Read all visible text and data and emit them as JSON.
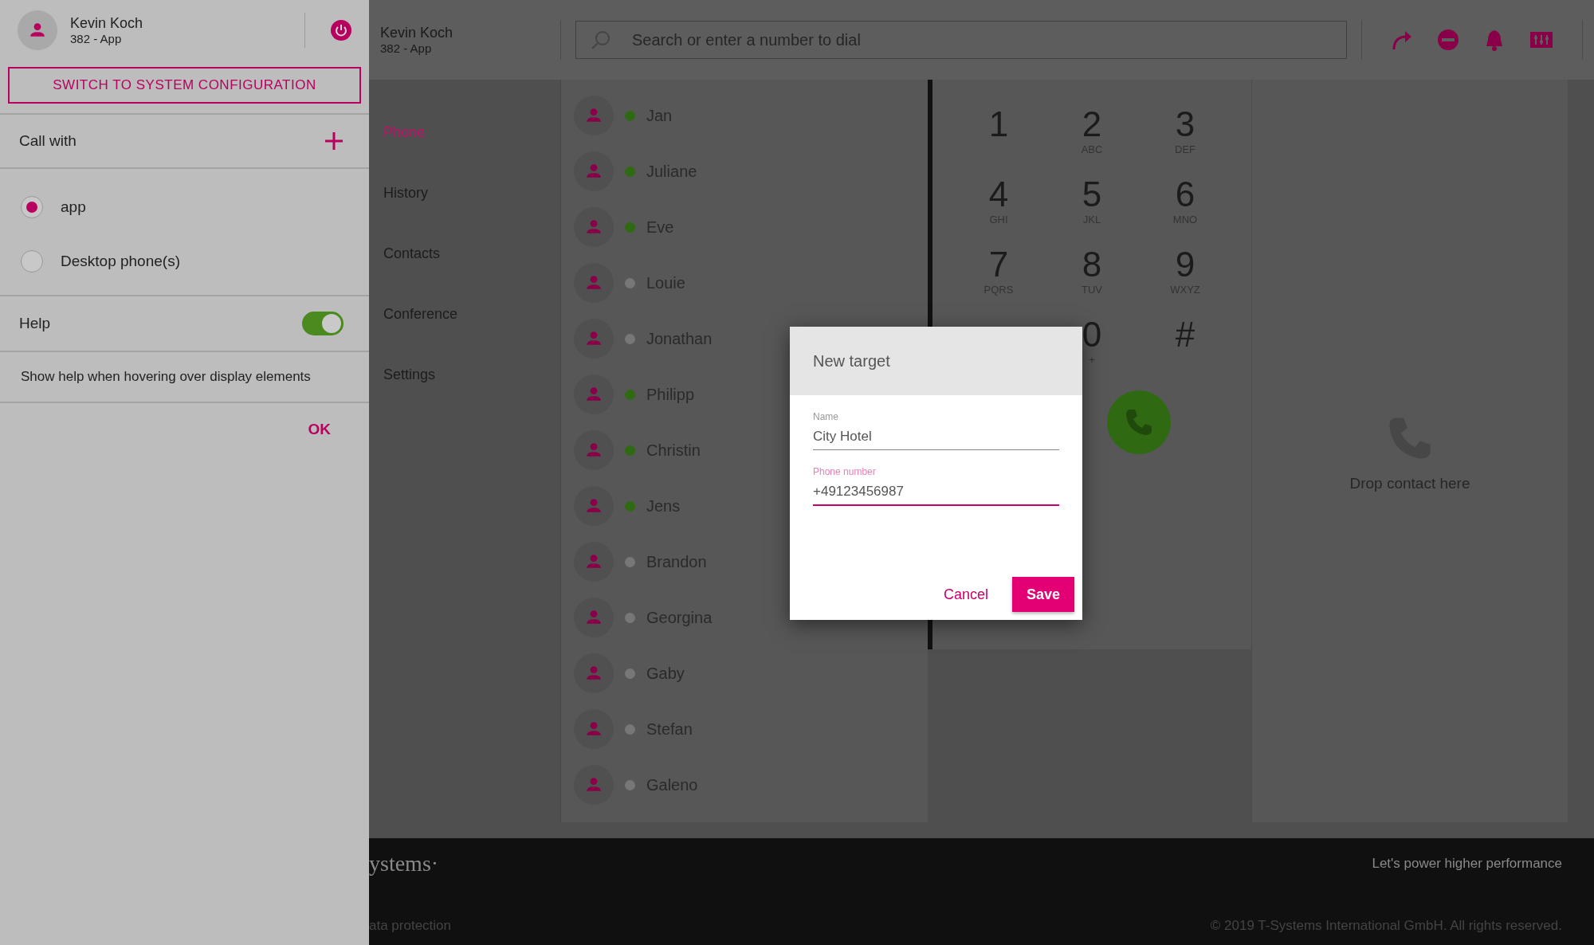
{
  "side_panel": {
    "user": {
      "name": "Kevin Koch",
      "extension": "382 - App"
    },
    "switch_button": "SWITCH TO SYSTEM CONFIGURATION",
    "call_with": "Call with",
    "call_options": [
      {
        "label": "app",
        "selected": true
      },
      {
        "label": "Desktop phone(s)",
        "selected": false
      }
    ],
    "help": {
      "label": "Help",
      "on": true
    },
    "help_description": "Show help when hovering over display elements",
    "ok_button": "OK"
  },
  "top_bar": {
    "user": {
      "name": "Kevin Koch",
      "extension": "382 - App"
    },
    "search": {
      "placeholder": "Search or enter a number to dial"
    }
  },
  "nav": [
    {
      "label": "Phone",
      "selected": true
    },
    {
      "label": "History",
      "selected": false
    },
    {
      "label": "Contacts",
      "selected": false
    },
    {
      "label": "Conference",
      "selected": false
    },
    {
      "label": "Settings",
      "selected": false
    }
  ],
  "contacts": [
    {
      "name": "Jan",
      "color": "#2e6a12"
    },
    {
      "name": "Juliane",
      "color": "#2e6a12"
    },
    {
      "name": "Eve",
      "color": "#2e6a12"
    },
    {
      "name": "Louie",
      "color": "#777777"
    },
    {
      "name": "Jonathan",
      "color": "#777777"
    },
    {
      "name": "Philipp",
      "color": "#2e6a12"
    },
    {
      "name": "Christin",
      "color": "#2e6a12"
    },
    {
      "name": "Jens",
      "color": "#2e6a12"
    },
    {
      "name": "Brandon",
      "color": "#777777"
    },
    {
      "name": "Georgina",
      "color": "#777777"
    },
    {
      "name": "Gaby",
      "color": "#777777"
    },
    {
      "name": "Stefan",
      "color": "#777777"
    },
    {
      "name": "Galeno",
      "color": "#777777"
    }
  ],
  "keypad": [
    {
      "digit": "1"
    },
    {
      "digit": "2",
      "letters": "ABC"
    },
    {
      "digit": "3",
      "letters": "DEF"
    },
    {
      "digit": "4",
      "letters": "GHI"
    },
    {
      "digit": "5",
      "letters": "JKL"
    },
    {
      "digit": "6",
      "letters": "MNO"
    },
    {
      "digit": "7",
      "letters": "PQRS"
    },
    {
      "digit": "8",
      "letters": "TUV"
    },
    {
      "digit": "9",
      "letters": "WXYZ"
    },
    {
      "digit": "0",
      "letters": "+"
    },
    {
      "digit": "#"
    }
  ],
  "drop_zone": {
    "label": "Drop contact here"
  },
  "dialog": {
    "title": "New target",
    "fields": [
      {
        "label": "Name",
        "value": "City Hotel",
        "focused": false
      },
      {
        "label": "Phone number",
        "value": "+49123456987",
        "focused": true
      }
    ],
    "buttons": [
      {
        "label": "Cancel",
        "kind": "text"
      },
      {
        "label": "Save",
        "kind": "primary"
      }
    ]
  },
  "footer": {
    "logo": "ystems·",
    "link": "ata protection",
    "tagline": "Let's power higher performance",
    "copyright": "© 2019 T-Systems International GmbH. All rights reserved."
  }
}
